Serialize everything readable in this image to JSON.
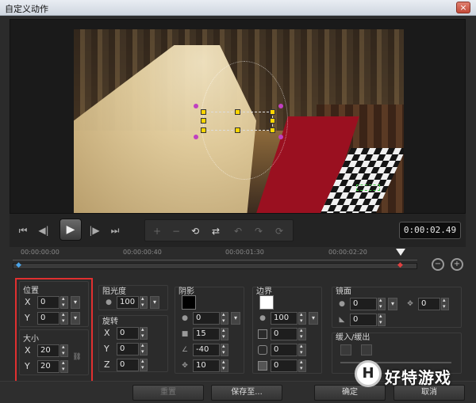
{
  "window": {
    "title": "自定义动作",
    "close_glyph": "×"
  },
  "transport": {
    "buttons": [
      "⏮",
      "◀|",
      "▶",
      "|▶",
      "⏭"
    ],
    "tools": [
      "+",
      "−",
      "⟲",
      "⇄",
      "↶",
      "↷",
      "⟳"
    ],
    "timecode": "0:00:02.49"
  },
  "timeline": {
    "ticks": [
      "00:00:00:00",
      "00:00:00:40",
      "00:00:01:30",
      "00:00:02:20"
    ]
  },
  "position": {
    "title": "位置",
    "x_label": "X",
    "x_value": "0",
    "y_label": "Y",
    "y_value": "0"
  },
  "size": {
    "title": "大小",
    "x_label": "X",
    "x_value": "20",
    "y_label": "Y",
    "y_value": "20",
    "link_icon": "⛓"
  },
  "opacity": {
    "title": "阻光度",
    "value": "100"
  },
  "rotation": {
    "title": "旋转",
    "x_label": "X",
    "x_value": "0",
    "y_label": "Y",
    "y_value": "0",
    "z_label": "Z",
    "z_value": "0"
  },
  "shadow": {
    "title": "阴影",
    "color": "#000000",
    "opacity": "0",
    "size": "15",
    "angle": "-40",
    "distance": "10"
  },
  "border": {
    "title": "边界",
    "color": "#ffffff",
    "opacity": "100",
    "width": "0",
    "blur": "0",
    "corner": "0"
  },
  "mirror": {
    "title": "镜面",
    "opacity": "0",
    "distance": "0",
    "offset": "0"
  },
  "ease": {
    "title": "缓入/缓出"
  },
  "footer": {
    "reset": "重置",
    "save_to": "保存至...",
    "ok": "确定",
    "cancel": "取消"
  },
  "watermark": {
    "logo_letter": "H",
    "text": "好特游戏"
  }
}
